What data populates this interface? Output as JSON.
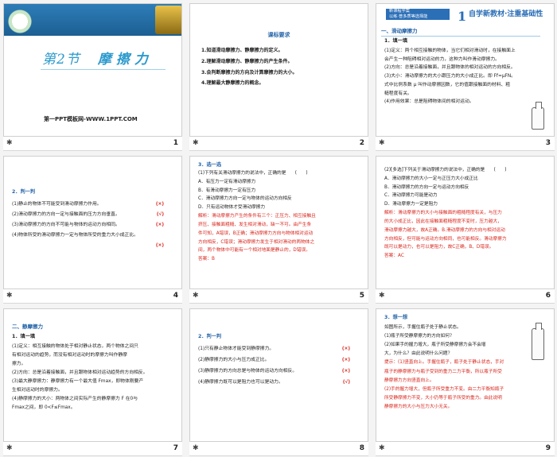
{
  "slides": [
    {
      "num": "1",
      "section": "第2节",
      "title": "摩擦力",
      "footer": "第一PPT模板网-WWW.1PPT.COM"
    },
    {
      "num": "2",
      "heading": "课标要求",
      "items": [
        "1.知道滑动摩擦力、静摩擦力的定义。",
        "2.理解滑动摩擦力、静摩擦力的产生条件。",
        "3.会判断摩擦力的方向及计算摩擦力的大小。",
        "4.理解最大静摩擦力的概念。"
      ]
    },
    {
      "num": "3",
      "banner_tag1": "新课程学案",
      "banner_tag2": "以练·普多质等选择能",
      "banner_num": "1",
      "banner_text": "自学新教材·注重基础性",
      "section": "一、滑动摩擦力",
      "sub": "1．填一填",
      "lines": [
        "(1)定义：两个相互接触的物体，当它们相对滑动时，在接触面上",
        "会产生一种阻碍相对运动的力，这种力叫作滑动摩擦力。",
        "(2)方向：总是沿着接触面，并且跟物体的相对运动的方向相反。",
        "(3)大小：滑动摩擦力的大小跟压力的大小成正比。即 Ff=μFN。",
        "式中比例系数 μ 叫作动摩擦因数，它的值跟接触面的材料、粗",
        "糙程度有关。",
        "(4)作用效果：总是阻碍物体间的相对运动。"
      ]
    },
    {
      "num": "4",
      "sub": "2．判一判",
      "items": [
        {
          "text": "(1)静止的物体不可能受到滑动摩擦力作用。",
          "mark": "(×)"
        },
        {
          "text": "(2)滑动摩擦力的方向一定与接触面的压力方向垂直。",
          "mark": "(√)"
        },
        {
          "text": "(3)滑动摩擦力的方向不可能与物体的运动方向相同。",
          "mark": "(×)"
        },
        {
          "text": "(4)物体所受的滑动摩擦力一定与物体所受的重力大小成正比。",
          "mark": "(×)"
        }
      ]
    },
    {
      "num": "5",
      "sub": "3．选一选",
      "lines": [
        "(1)下列有关滑动摩擦力的说法中，正确的是　　(　　)",
        "A．有压力一定有滑动摩擦力",
        "B．有滑动摩擦力一定有压力",
        "C．滑动摩擦力方向一定与物体的运动方向相反",
        "D．只有运动物体才受滑动摩擦力",
        "解析：滑动摩擦力产生的条件有三个：正压力、相互接触且",
        "挤压、接触面粗糙、发生相对滑动，缺一不可。由产生条",
        "件可知，A错误，B正确；滑动摩擦力方向与物体相对运动",
        "方向相反，C错误；滑动摩擦力发生于相对滑动的两物体之",
        "间，两个物体中可能有一个相对地面是静止的，D错误。",
        "答案：B"
      ]
    },
    {
      "num": "6",
      "lines": [
        "(2)[多选]下列关于滑动摩擦力的说法中，正确的是　　(　　)",
        "A．滑动摩擦力的大小一定与正压力大小成正比",
        "B．滑动摩擦力的方向一定与运动方向相反",
        "C．滑动摩擦力可能是动力",
        "D．滑动摩擦力一定是阻力",
        "解析：滑动摩擦力的大小与接触面的粗糙程度有关，与压力",
        "的大小成正比，因此在接触面粗糙程度不变时，压力越大，",
        "滑动摩擦力越大，故A正确。B.滑动摩擦力的方向与相对运动",
        "方向相反，但可能与运动方向相同，也可能相反。滑动摩擦力",
        "既可以是动力，也可以是阻力，故C正确，B、D错误。",
        "答案：AC"
      ]
    },
    {
      "num": "7",
      "section": "二、静摩擦力",
      "sub": "1．填一填",
      "lines": [
        "(1)定义：相互接触的物体处于相对静止状态，两个物体之间只",
        "有相对运动的趋势，而没有相对运动时的摩擦力叫作静摩",
        "擦力。",
        "(2)方向：总是沿着接触面，并且跟物体相对运动趋势的方向相反。",
        "(3)最大静摩擦力：静摩擦力有一个最大值 Fmax，即物体刚要产",
        "生相对运动时的摩擦力。",
        "(4)静摩擦力的大小：两物体之间实际产生的静摩擦力 F 在0与",
        "Fmax之间，即 0<F≤Fmax。"
      ]
    },
    {
      "num": "8",
      "sub": "2．判一判",
      "items": [
        {
          "text": "(1)只有静止物体才能受到静摩擦力。",
          "mark": "(×)"
        },
        {
          "text": "(2)静摩擦力的大小与压力成正比。",
          "mark": "(×)"
        },
        {
          "text": "(3)静摩擦力的方向总是与物体的运动方向相反。",
          "mark": "(×)"
        },
        {
          "text": "(4)静摩擦力既可以是阻力也可以是动力。",
          "mark": "(√)"
        }
      ]
    },
    {
      "num": "9",
      "sub": "3．想一想",
      "lines": [
        "如图所示，手握住瓶子处于静止状态。",
        "(1)瓶子所受静摩擦力的方向如何？",
        "(2)如果手的握力增大，瓶子所受静摩擦力会不会增",
        "大，为什么？由此说明什么问题？",
        "提示：(1)竖直向上。手握住瓶子，瓶子处于静止状态，手对",
        "瓶子的静摩擦力与瓶子受到的重力二力平衡，所以瓶子所受",
        "静摩擦力方向竖直向上。",
        "(2)手的握力增大，但瓶子所受重力不变。由二力平衡知瓶子",
        "所受静摩擦力不变，大小仍等于瓶子所受的重力。由此说明",
        "静摩擦力的大小与压力大小无关。"
      ]
    }
  ]
}
